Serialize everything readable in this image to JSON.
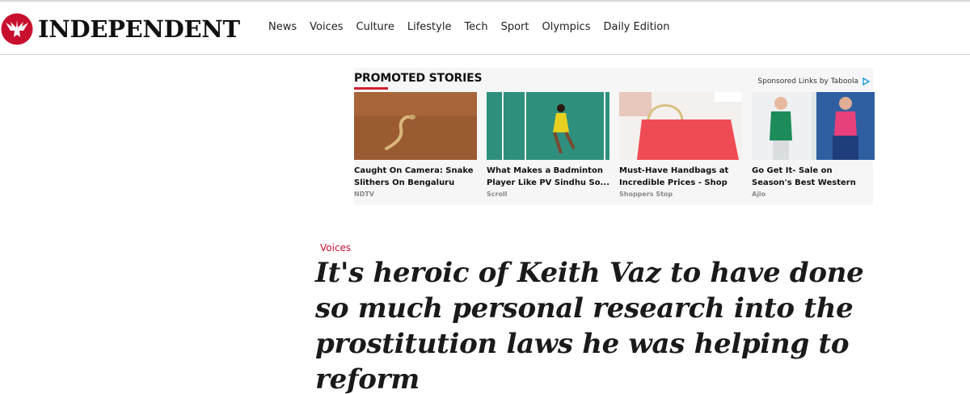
{
  "header": {
    "logo_text": "INDEPENDENT",
    "nav": [
      "News",
      "Voices",
      "Culture",
      "Lifestyle",
      "Tech",
      "Sport",
      "Olympics",
      "Daily Edition"
    ]
  },
  "promoted": {
    "title": "PROMOTED STORIES",
    "sponsor_text": "Sponsored Links by Taboola",
    "cards": [
      {
        "headline": "Caught On Camera: Snake Slithers On Bengaluru Roa...",
        "source": "NDTV"
      },
      {
        "headline": "What Makes a Badminton Player Like PV Sindhu So...",
        "source": "Scroll"
      },
      {
        "headline": "Must-Have Handbags at Incredible Prices - Shop Now",
        "source": "Shoppers Stop"
      },
      {
        "headline": "Go Get It- Sale on Season's Best Western Outfits!",
        "source": "Ajio"
      }
    ]
  },
  "article": {
    "section": "Voices",
    "title": "It's heroic of Keith Vaz to have done so much personal research into the prostitution laws he was helping to reform"
  },
  "colors": {
    "brand_red": "#c8102e",
    "promo_accent": "#d0202e",
    "promo_bg": "#f6f6f6"
  },
  "icons": [
    "eagle-logo-icon",
    "taboola-icon"
  ]
}
